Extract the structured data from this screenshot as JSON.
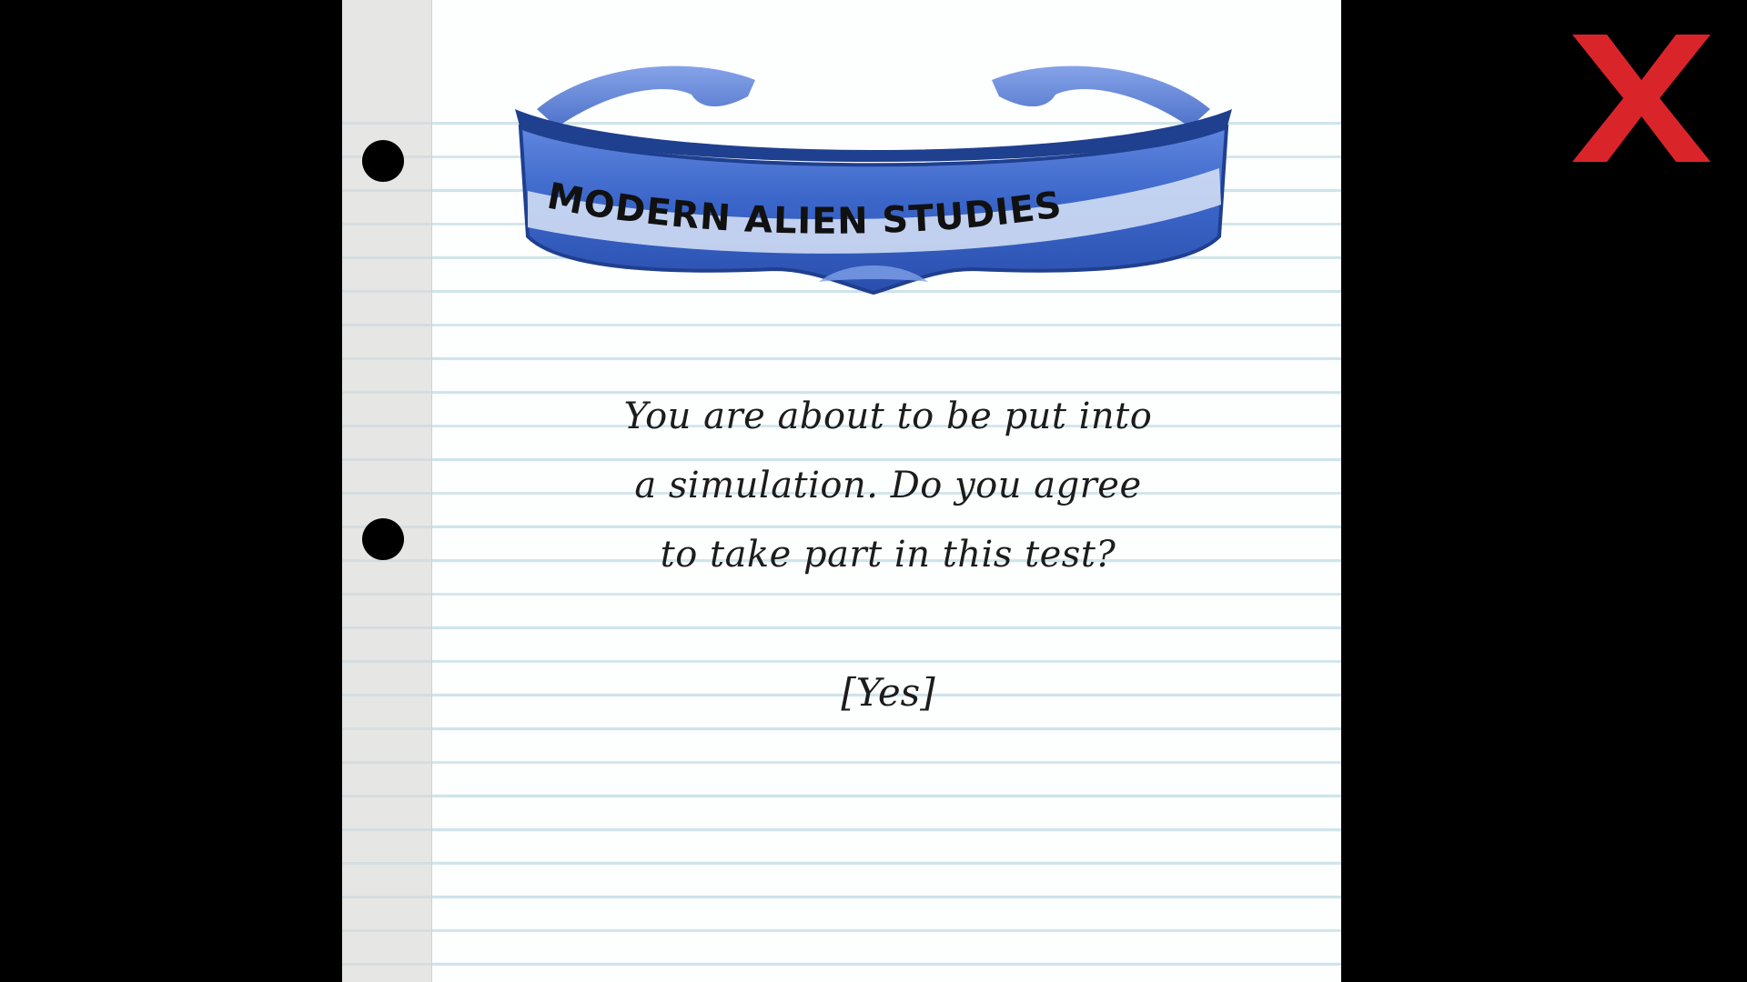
{
  "logo": {
    "text": "MODERN ALIEN STUDIES",
    "lens_color": "#3b66c9",
    "text_color": "#111111"
  },
  "prompt": {
    "lines": [
      "You are about to be put into",
      "a simulation. Do you agree",
      "to take part in this test?"
    ]
  },
  "actions": {
    "yes_label": "[Yes]",
    "close_icon": "close-x-icon",
    "close_color": "#d9252a"
  },
  "theme": {
    "background": "#000000",
    "paper": "#fdfefe",
    "rule_line": "#cfe4ea",
    "margin": "#e6e6e4"
  }
}
